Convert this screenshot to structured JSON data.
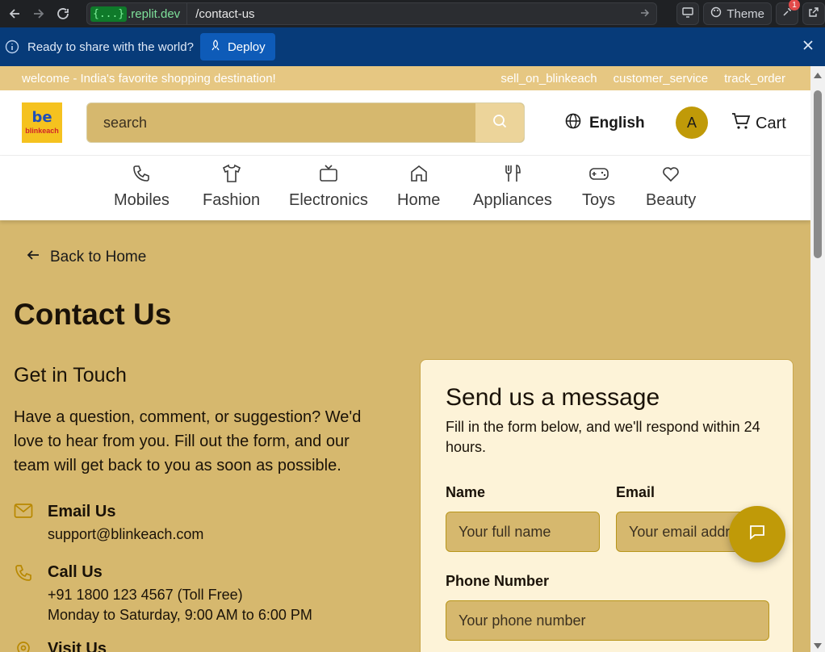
{
  "browser": {
    "domain_prefix": "{...}",
    "domain": ".replit.dev",
    "path": "/contact-us",
    "theme_label": "Theme",
    "notification_count": "1"
  },
  "deploy_bar": {
    "message": "Ready to share with the world?",
    "button_label": "Deploy"
  },
  "top_strip": {
    "welcome": "welcome - India's favorite shopping destination!",
    "links": [
      "sell_on_blinkeach",
      "customer_service",
      "track_order"
    ]
  },
  "header": {
    "logo_text": "blinkeach",
    "logo_mark": "be",
    "search_placeholder": "search",
    "language": "English",
    "avatar_initial": "A",
    "cart_label": "Cart"
  },
  "categories": [
    {
      "label": "Mobiles",
      "icon": "phone-icon"
    },
    {
      "label": "Fashion",
      "icon": "shirt-icon"
    },
    {
      "label": "Electronics",
      "icon": "tv-icon"
    },
    {
      "label": "Home",
      "icon": "home-icon"
    },
    {
      "label": "Appliances",
      "icon": "utensils-icon"
    },
    {
      "label": "Toys",
      "icon": "gamepad-icon"
    },
    {
      "label": "Beauty",
      "icon": "heart-icon"
    }
  ],
  "main": {
    "back_label": "Back to Home",
    "title": "Contact Us",
    "get_in_touch": "Get in Touch",
    "description": "Have a question, comment, or suggestion? We'd love to hear from you. Fill out the form, and our team will get back to you as soon as possible.",
    "contacts": [
      {
        "title": "Email Us",
        "lines": [
          "support@blinkeach.com"
        ]
      },
      {
        "title": "Call Us",
        "lines": [
          "+91 1800 123 4567 (Toll Free)",
          "Monday to Saturday, 9:00 AM to 6:00 PM"
        ]
      },
      {
        "title": "Visit Us",
        "lines": []
      }
    ]
  },
  "form": {
    "title": "Send us a message",
    "subtitle": "Fill in the form below, and we'll respond within 24 hours.",
    "name_label": "Name",
    "name_placeholder": "Your full name",
    "email_label": "Email",
    "email_placeholder": "Your email address",
    "phone_label": "Phone Number",
    "phone_placeholder": "Your phone number"
  },
  "colors": {
    "page_bg": "#d6b86e",
    "accent": "#c09a08",
    "card_bg": "#fdf3d8",
    "deploy_bar": "#073b79"
  }
}
